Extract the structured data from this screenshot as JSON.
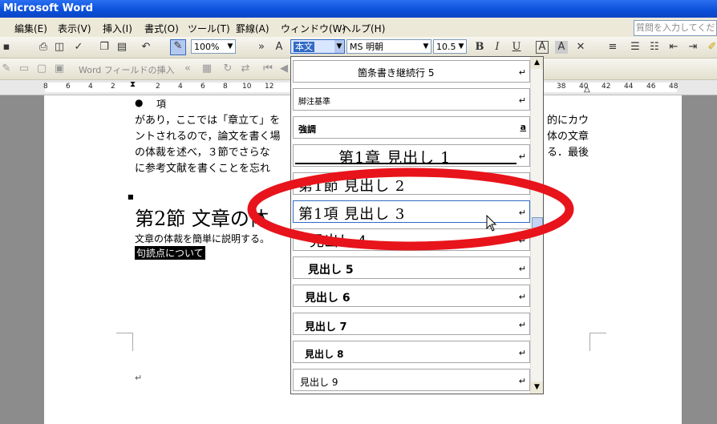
{
  "window": {
    "title": "Microsoft Word"
  },
  "menubar": {
    "items": [
      "編集(E)",
      "表示(V)",
      "挿入(I)",
      "書式(O)",
      "ツール(T)",
      "罫線(A)",
      "ウィンドウ(W)",
      "ヘルプ(H)"
    ],
    "help_placeholder": "質問を入力してくださ"
  },
  "toolbar": {
    "zoom": "100%",
    "style": "本文",
    "font": "MS 明朝",
    "size": "10.5",
    "bold": "B",
    "italic": "I",
    "underline": "U",
    "field_insert": "Word フィールドの挿入"
  },
  "ruler": {
    "numbers": [
      "8",
      "6",
      "4",
      "2",
      "2",
      "4",
      "6",
      "8",
      "10",
      "12",
      "38",
      "40",
      "42",
      "44",
      "46",
      "48"
    ]
  },
  "document": {
    "bullet_item": "項",
    "para1_lines": [
      "があり，ここでは「章立て」を",
      "ントされるので，論文を書く場",
      "の体裁を述べ，３節でさらな",
      "に参考文献を書くことを忘れ"
    ],
    "para1_right": [
      "的にカウ",
      "体の文章",
      "る．最後"
    ],
    "heading": "第2節 文章の体",
    "body1": "文章の体裁を簡単に説明する。",
    "body2": "句読点について",
    "return_mark": "↵"
  },
  "style_dropdown": {
    "items": [
      {
        "label": "箇条書き継続行 5",
        "mark": "↵"
      },
      {
        "label": "脚注基準",
        "mark": "↵"
      },
      {
        "label": "強調",
        "mark": "a"
      },
      {
        "label": "第1章 見出し 1",
        "mark": "↵"
      },
      {
        "label": "第1節 見出し 2",
        "mark": "↵"
      },
      {
        "label": "第1項 見出し 3",
        "mark": "↵"
      },
      {
        "label": "見出し 4",
        "mark": "↵"
      },
      {
        "label": "見出し 5",
        "mark": "↵"
      },
      {
        "label": "見出し 6",
        "mark": "↵"
      },
      {
        "label": "見出し 7",
        "mark": "↵"
      },
      {
        "label": "見出し 8",
        "mark": "↵"
      },
      {
        "label": "見出し 9",
        "mark": "↵"
      }
    ]
  },
  "colors": {
    "highlight_ellipse": "#e8141b",
    "title_bar": "#0a4fd8"
  }
}
